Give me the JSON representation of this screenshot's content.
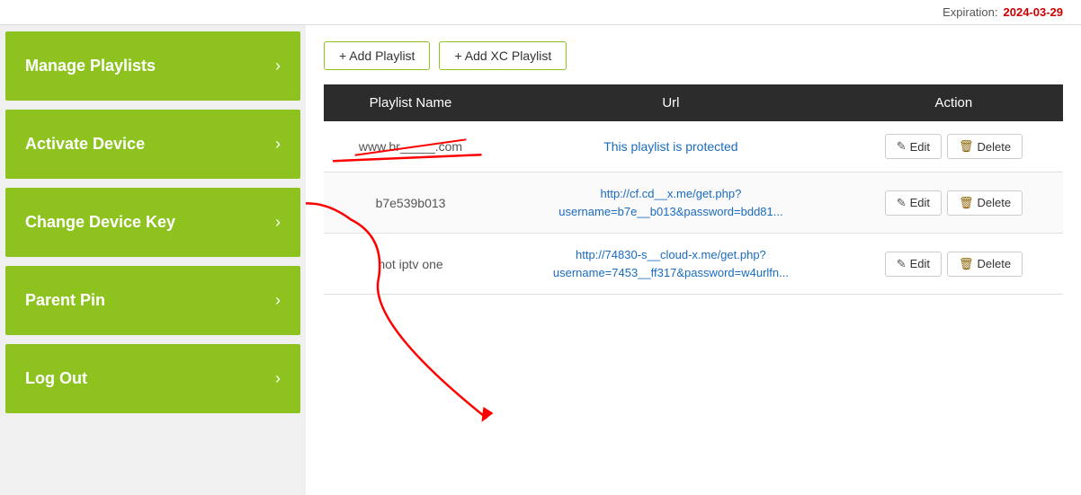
{
  "topbar": {
    "expiration_label": "Expiration:",
    "expiration_value": "2024-03-29"
  },
  "sidebar": {
    "items": [
      {
        "id": "manage-playlists",
        "label": "Manage Playlists",
        "active": true
      },
      {
        "id": "activate-device",
        "label": "Activate Device",
        "active": false
      },
      {
        "id": "change-device-key",
        "label": "Change Device Key",
        "active": false
      },
      {
        "id": "parent-pin",
        "label": "Parent Pin",
        "active": false
      },
      {
        "id": "log-out",
        "label": "Log Out",
        "active": false
      }
    ],
    "chevron": "›"
  },
  "content": {
    "add_playlist_label": "+ Add Playlist",
    "add_xc_playlist_label": "+ Add XC Playlist",
    "table": {
      "columns": [
        "Playlist Name",
        "Url",
        "Action"
      ],
      "rows": [
        {
          "name": "www.br_____.com",
          "url": "This playlist is protected",
          "url_type": "protected",
          "edit_label": "Edit",
          "delete_label": "Delete"
        },
        {
          "name": "b7e539b013",
          "url": "http://cf.cd__x.me/get.php?\nusername=b7e__b013&password=bdd81...",
          "url_type": "link",
          "edit_label": "Edit",
          "delete_label": "Delete"
        },
        {
          "name": "hot iptv one",
          "url": "http://74830-s__cloud-x.me/get.php?\nusername=7453__ff317&password=w4urlfn...",
          "url_type": "link",
          "edit_label": "Edit",
          "delete_label": "Delete"
        }
      ]
    }
  },
  "icons": {
    "edit": "✎",
    "delete": "🗑",
    "chevron": "›"
  }
}
